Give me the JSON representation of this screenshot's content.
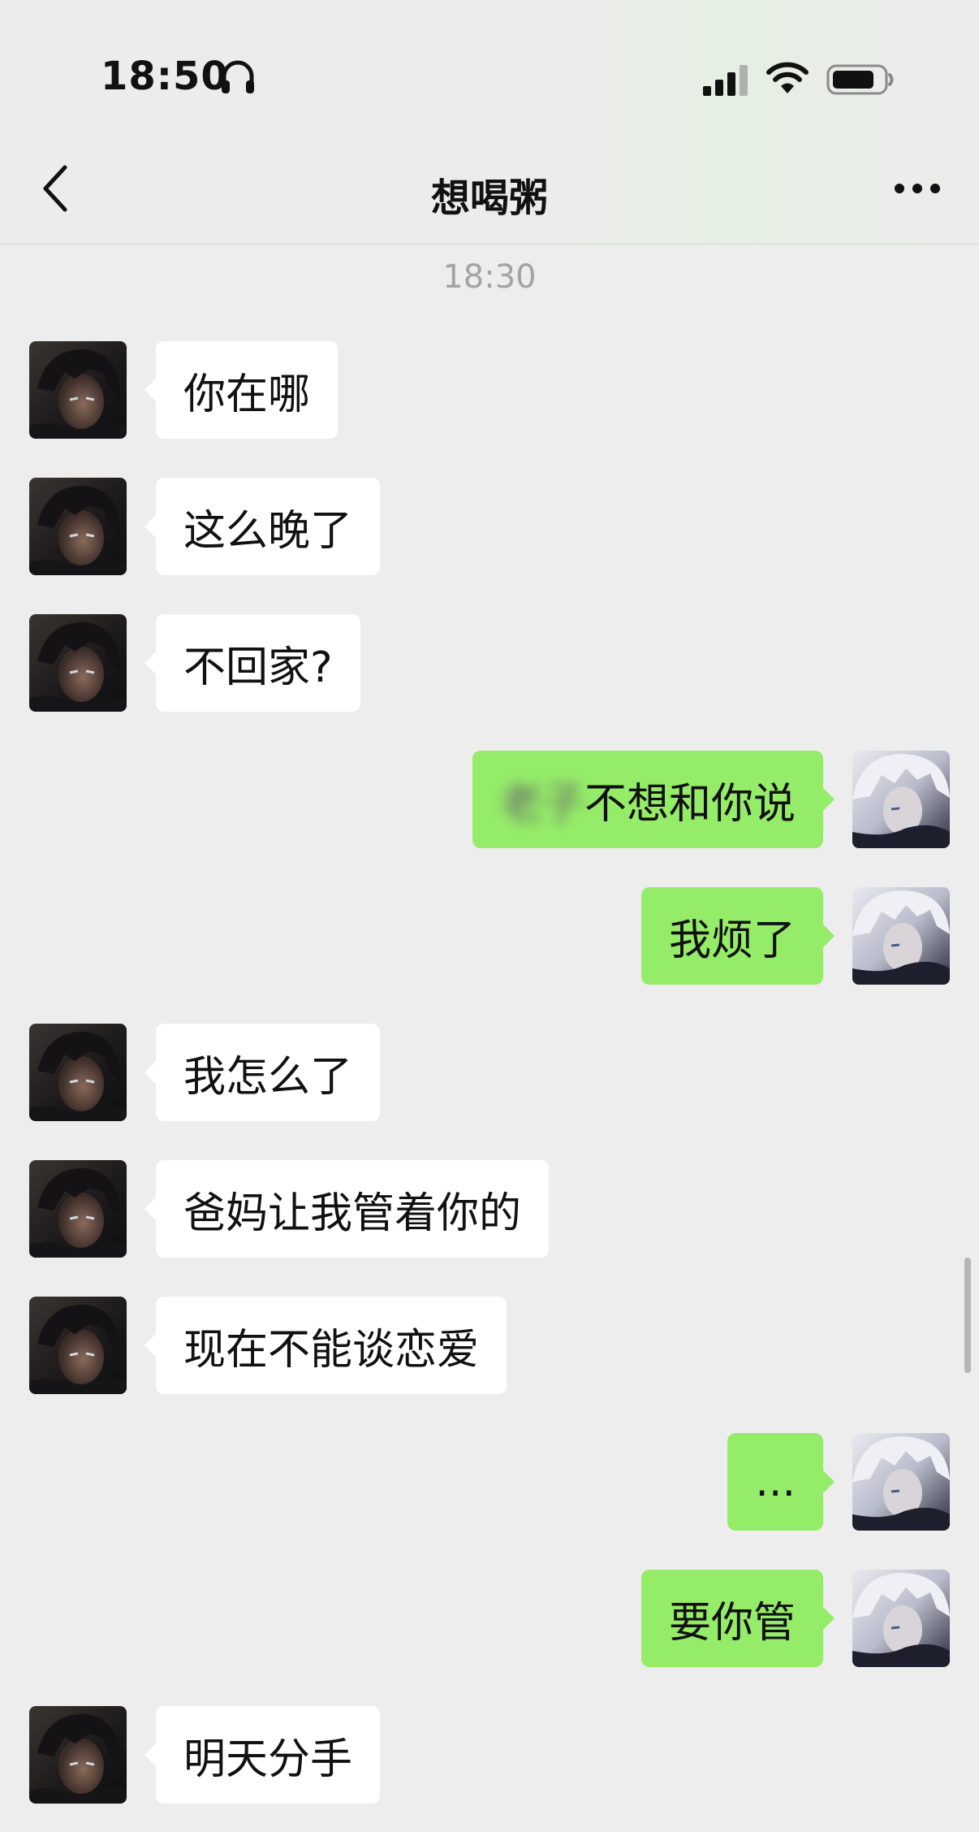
{
  "status_bar": {
    "time": "18:50"
  },
  "header": {
    "title": "想喝粥"
  },
  "timestamp": "18:30",
  "messages": [
    {
      "side": "left",
      "text": "你在哪"
    },
    {
      "side": "left",
      "text": "这么晚了"
    },
    {
      "side": "left",
      "text": "不回家?"
    },
    {
      "side": "right",
      "text_blurred": "老子",
      "text": "不想和你说"
    },
    {
      "side": "right",
      "text": "我烦了"
    },
    {
      "side": "left",
      "text": "我怎么了"
    },
    {
      "side": "left",
      "text": "爸妈让我管着你的"
    },
    {
      "side": "left",
      "text": "现在不能谈恋爱"
    },
    {
      "side": "right",
      "text": "..."
    },
    {
      "side": "right",
      "text": "要你管"
    },
    {
      "side": "left",
      "text": "明天分手"
    }
  ],
  "colors": {
    "background": "#ededed",
    "self_bubble": "#95ec69",
    "other_bubble": "#ffffff"
  },
  "icons": [
    "headphones-icon",
    "signal-icon",
    "wifi-icon",
    "battery-icon",
    "back-arrow-icon",
    "more-icon"
  ]
}
